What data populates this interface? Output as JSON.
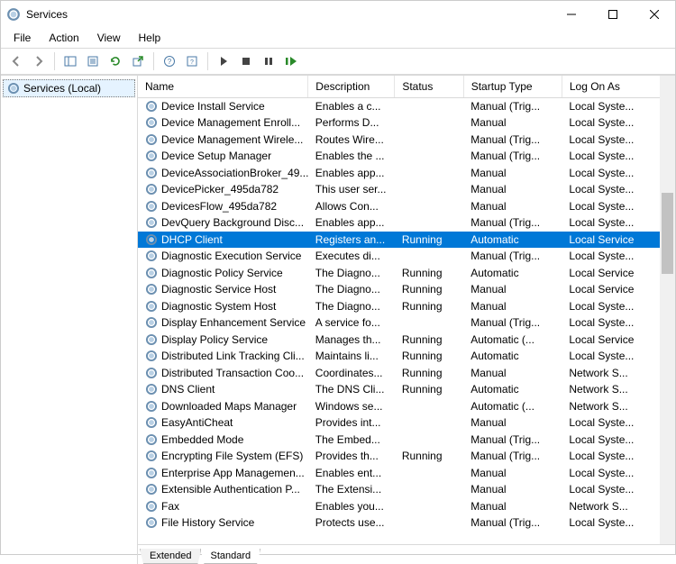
{
  "window": {
    "title": "Services"
  },
  "menu": {
    "file": "File",
    "action": "Action",
    "view": "View",
    "help": "Help"
  },
  "tree": {
    "root": "Services (Local)"
  },
  "columns": {
    "name": "Name",
    "description": "Description",
    "status": "Status",
    "startup": "Startup Type",
    "logon": "Log On As"
  },
  "tabs": {
    "extended": "Extended",
    "standard": "Standard"
  },
  "services": [
    {
      "name": "Device Install Service",
      "desc": "Enables a c...",
      "status": "",
      "startup": "Manual (Trig...",
      "logon": "Local Syste..."
    },
    {
      "name": "Device Management Enroll...",
      "desc": "Performs D...",
      "status": "",
      "startup": "Manual",
      "logon": "Local Syste..."
    },
    {
      "name": "Device Management Wirele...",
      "desc": "Routes Wire...",
      "status": "",
      "startup": "Manual (Trig...",
      "logon": "Local Syste..."
    },
    {
      "name": "Device Setup Manager",
      "desc": "Enables the ...",
      "status": "",
      "startup": "Manual (Trig...",
      "logon": "Local Syste..."
    },
    {
      "name": "DeviceAssociationBroker_49...",
      "desc": "Enables app...",
      "status": "",
      "startup": "Manual",
      "logon": "Local Syste..."
    },
    {
      "name": "DevicePicker_495da782",
      "desc": "This user ser...",
      "status": "",
      "startup": "Manual",
      "logon": "Local Syste..."
    },
    {
      "name": "DevicesFlow_495da782",
      "desc": "Allows Con...",
      "status": "",
      "startup": "Manual",
      "logon": "Local Syste..."
    },
    {
      "name": "DevQuery Background Disc...",
      "desc": "Enables app...",
      "status": "",
      "startup": "Manual (Trig...",
      "logon": "Local Syste..."
    },
    {
      "name": "DHCP Client",
      "desc": "Registers an...",
      "status": "Running",
      "startup": "Automatic",
      "logon": "Local Service",
      "selected": true
    },
    {
      "name": "Diagnostic Execution Service",
      "desc": "Executes di...",
      "status": "",
      "startup": "Manual (Trig...",
      "logon": "Local Syste..."
    },
    {
      "name": "Diagnostic Policy Service",
      "desc": "The Diagno...",
      "status": "Running",
      "startup": "Automatic",
      "logon": "Local Service"
    },
    {
      "name": "Diagnostic Service Host",
      "desc": "The Diagno...",
      "status": "Running",
      "startup": "Manual",
      "logon": "Local Service"
    },
    {
      "name": "Diagnostic System Host",
      "desc": "The Diagno...",
      "status": "Running",
      "startup": "Manual",
      "logon": "Local Syste..."
    },
    {
      "name": "Display Enhancement Service",
      "desc": "A service fo...",
      "status": "",
      "startup": "Manual (Trig...",
      "logon": "Local Syste..."
    },
    {
      "name": "Display Policy Service",
      "desc": "Manages th...",
      "status": "Running",
      "startup": "Automatic (...",
      "logon": "Local Service"
    },
    {
      "name": "Distributed Link Tracking Cli...",
      "desc": "Maintains li...",
      "status": "Running",
      "startup": "Automatic",
      "logon": "Local Syste..."
    },
    {
      "name": "Distributed Transaction Coo...",
      "desc": "Coordinates...",
      "status": "Running",
      "startup": "Manual",
      "logon": "Network S..."
    },
    {
      "name": "DNS Client",
      "desc": "The DNS Cli...",
      "status": "Running",
      "startup": "Automatic",
      "logon": "Network S..."
    },
    {
      "name": "Downloaded Maps Manager",
      "desc": "Windows se...",
      "status": "",
      "startup": "Automatic (...",
      "logon": "Network S..."
    },
    {
      "name": "EasyAntiCheat",
      "desc": "Provides int...",
      "status": "",
      "startup": "Manual",
      "logon": "Local Syste..."
    },
    {
      "name": "Embedded Mode",
      "desc": "The Embed...",
      "status": "",
      "startup": "Manual (Trig...",
      "logon": "Local Syste..."
    },
    {
      "name": "Encrypting File System (EFS)",
      "desc": "Provides th...",
      "status": "Running",
      "startup": "Manual (Trig...",
      "logon": "Local Syste..."
    },
    {
      "name": "Enterprise App Managemen...",
      "desc": "Enables ent...",
      "status": "",
      "startup": "Manual",
      "logon": "Local Syste..."
    },
    {
      "name": "Extensible Authentication P...",
      "desc": "The Extensi...",
      "status": "",
      "startup": "Manual",
      "logon": "Local Syste..."
    },
    {
      "name": "Fax",
      "desc": "Enables you...",
      "status": "",
      "startup": "Manual",
      "logon": "Network S..."
    },
    {
      "name": "File History Service",
      "desc": "Protects use...",
      "status": "",
      "startup": "Manual (Trig...",
      "logon": "Local Syste..."
    }
  ]
}
